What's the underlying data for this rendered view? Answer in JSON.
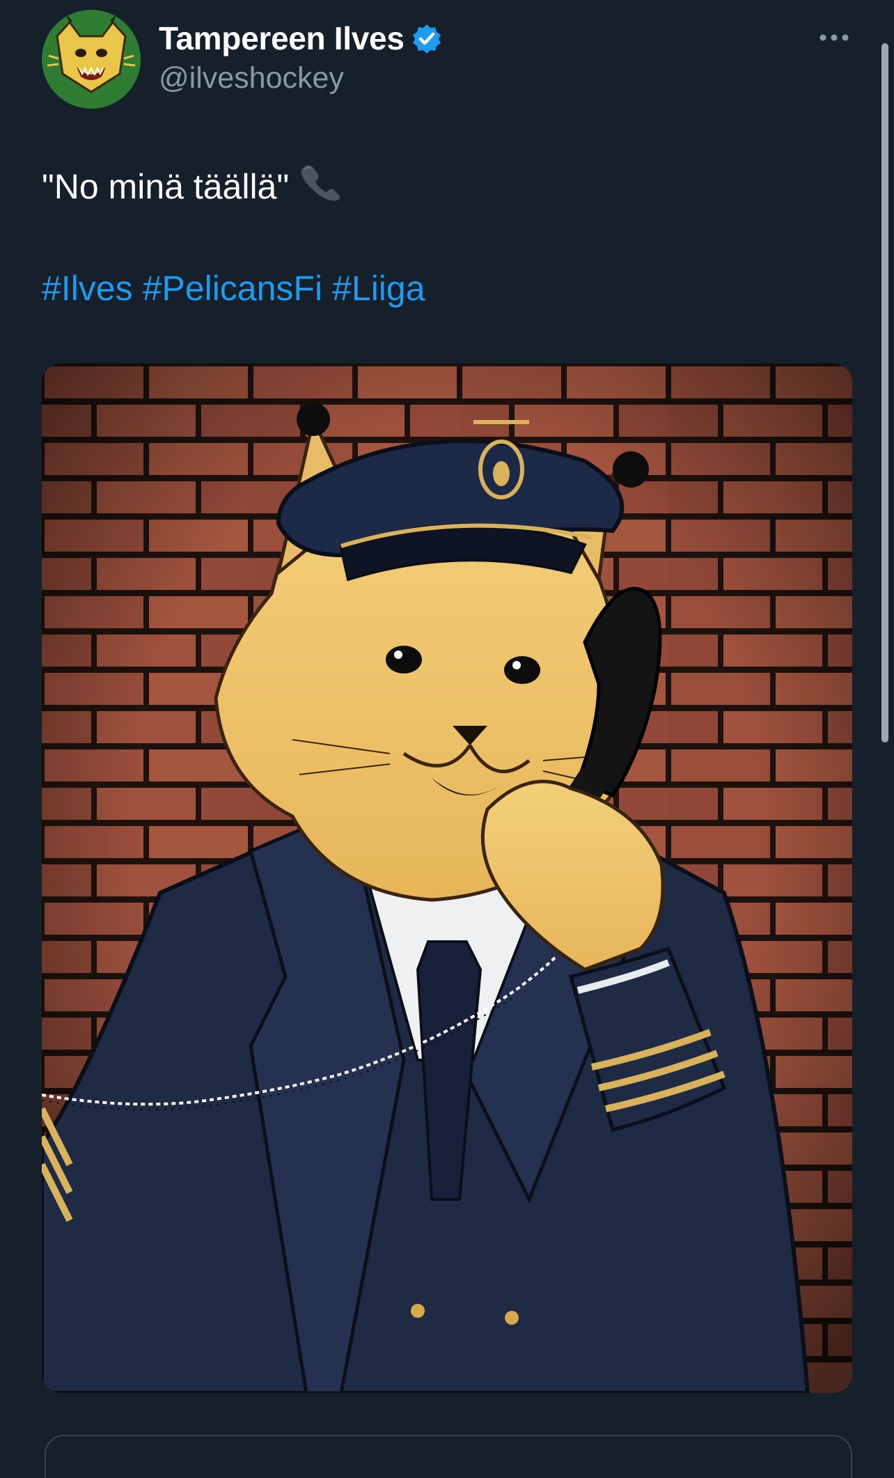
{
  "author": {
    "display_name": "Tampereen Ilves",
    "handle": "@ilveshockey",
    "verified": true,
    "avatar_icon": "lynx-logo-icon"
  },
  "tweet": {
    "text": "\"No minä täällä\"",
    "emoji_icon": "telephone-receiver-icon",
    "hashtags": [
      "#Ilves",
      "#PelicansFi",
      "#Liiga"
    ]
  },
  "media": {
    "image_icon": "lynx-pilot-on-phone-illustration"
  },
  "colors": {
    "background": "#15202b",
    "text": "#ffffff",
    "secondary_text": "#8b98a5",
    "link": "#1d9bf0",
    "verified_badge": "#1d9bf0"
  }
}
